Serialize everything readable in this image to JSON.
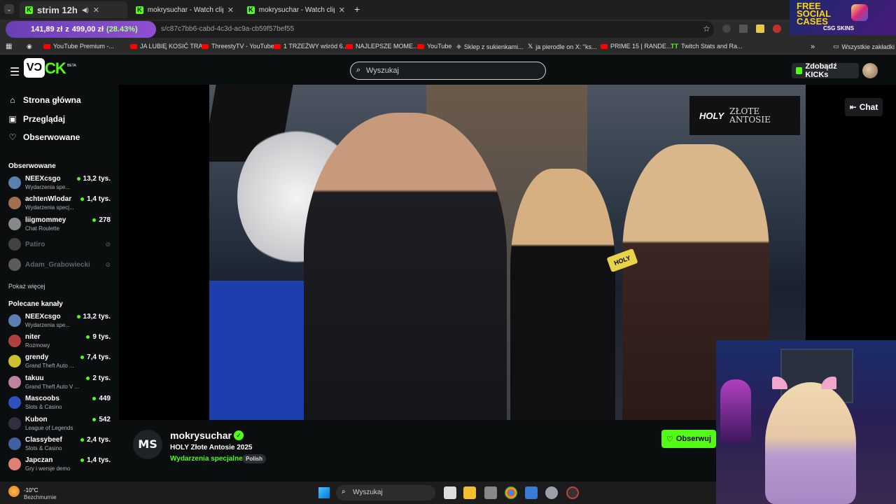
{
  "browser": {
    "tabs": [
      {
        "title": "strim 12h",
        "active": true
      },
      {
        "title": "mokrysuchar - Watch clips on K",
        "active": false
      },
      {
        "title": "mokrysuchar - Watch clips on K",
        "active": false
      }
    ],
    "url": "s/c87c7bb6-cabd-4c3d-ac9a-cb59f57bef55",
    "price_overlay": {
      "current": "141,89 zł",
      "sep": "z",
      "target": "499,00 zł",
      "pct": "(28.43%)"
    },
    "bookmarks": [
      "YouTube Premium -...",
      "JA LUBIĘ KOSIĆ TRA...",
      "ThreestyTV - YouTube",
      "1 TRZEŹWY wśród 6...",
      "NAJLEPSZE MOME...",
      "YouTube",
      "Sklep z sukienkami...",
      "ja pierodle on X: \"ks...",
      "PRIME 15 | RANDE...",
      "Twitch Stats and Ra..."
    ],
    "bookmarks_folder": "Wszystkie zakładki"
  },
  "ad": {
    "line1": "FREE",
    "line2": "SOCIAL",
    "line3": "CASES",
    "brand": "CSG SKINS"
  },
  "header": {
    "logo_box": "VƆ",
    "logo_text": "CK",
    "logo_beta": "BETA",
    "search_placeholder": "Wyszukaj",
    "kicks_button": "Zdobądź KICKs"
  },
  "sidebar": {
    "nav": [
      {
        "label": "Strona główna",
        "icon": "home-icon"
      },
      {
        "label": "Przeglądaj",
        "icon": "browse-icon"
      },
      {
        "label": "Obserwowane",
        "icon": "heart-icon"
      }
    ],
    "followed_title": "Obserwowane",
    "followed": [
      {
        "name": "NEEXcsgo",
        "category": "Wydarzenia spe...",
        "viewers": "13,2 tys.",
        "color": "#5b7fb0"
      },
      {
        "name": "achtenWlodar",
        "category": "Wydarzenia specj...",
        "viewers": "1,4 tys.",
        "color": "#a07050"
      },
      {
        "name": "liigmommey",
        "category": "Chat Roulette",
        "viewers": "278",
        "color": "#888888"
      },
      {
        "name": "Patiro",
        "offline": true,
        "color": "#777777"
      },
      {
        "name": "Adam_Grabowiecki",
        "offline": true,
        "color": "#aaaaaa"
      }
    ],
    "show_more": "Pokaż więcej",
    "recommended_title": "Polecane kanały",
    "recommended": [
      {
        "name": "NEEXcsgo",
        "category": "Wydarzenia spe...",
        "viewers": "13,2 tys.",
        "color": "#5b7fb0"
      },
      {
        "name": "niter",
        "category": "Rozmowy",
        "viewers": "9 tys.",
        "color": "#b04040"
      },
      {
        "name": "grendy",
        "category": "Grand Theft Auto ...",
        "viewers": "7,4 tys.",
        "color": "#d0c030"
      },
      {
        "name": "takuu",
        "category": "Grand Theft Auto V ...",
        "viewers": "2 tys.",
        "color": "#c080a0"
      },
      {
        "name": "Mascoobs",
        "category": "Slots & Casino",
        "viewers": "449",
        "color": "#3050c0"
      },
      {
        "name": "Kubon",
        "category": "League of Legends",
        "viewers": "542",
        "color": "#303040"
      },
      {
        "name": "Classybeef",
        "category": "Slots & Casino",
        "viewers": "2,4 tys.",
        "color": "#4060a0"
      },
      {
        "name": "Japczan",
        "category": "Gry i wersje demo",
        "viewers": "1,4 tys.",
        "color": "#e08070"
      }
    ]
  },
  "video": {
    "badge_brand": "HOLY",
    "badge_line1": "ZŁOTE",
    "badge_line2": "ANTOSIE"
  },
  "chat_button": "Chat",
  "channel": {
    "avatar_initials": "MS",
    "name": "mokrysuchar",
    "title": "HOLY Złote Antosie 2025",
    "category": "Wydarzenia specjalne",
    "language": "Polish",
    "follow_label": "Obserwuj"
  },
  "taskbar": {
    "temp": "-10°C",
    "weather": "Bezchmurnie",
    "search_placeholder": "Wyszukaj"
  }
}
